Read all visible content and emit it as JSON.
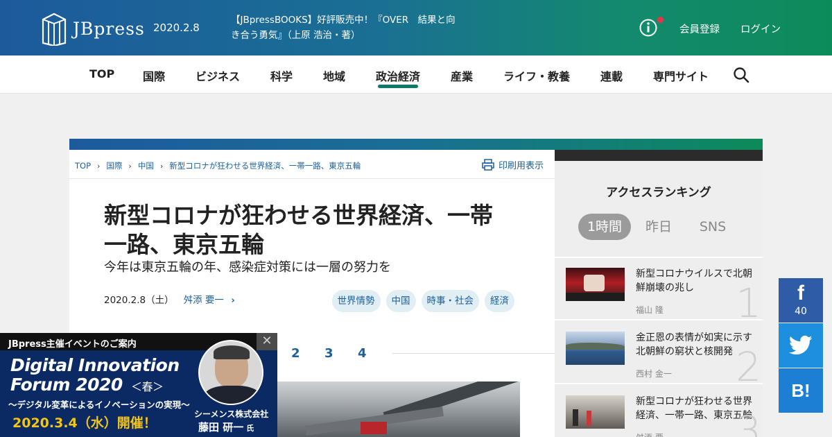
{
  "header": {
    "logo_text": "JBpress",
    "date": "2020.2.8",
    "promo_line1": "【JBpressBOOKS】好評販売中！『OVER　結果と向",
    "promo_line2": "き合う勇気』（上原 浩治・著）",
    "register": "会員登録",
    "login": "ログイン"
  },
  "nav": {
    "items": [
      "TOP",
      "国際",
      "ビジネス",
      "科学",
      "地域",
      "政治経済",
      "産業",
      "ライフ・教養",
      "連載",
      "専門サイト"
    ],
    "active": "政治経済"
  },
  "breadcrumb": [
    "TOP",
    "国際",
    "中国",
    "新型コロナが狂わせる世界経済、一帯一路、東京五輪"
  ],
  "print_label": "印刷用表示",
  "article": {
    "title_line1": "新型コロナが狂わせる世界経済、一帯",
    "title_line2": "一路、東京五輪",
    "subtitle": "今年は東京五輪の年、感染症対策には一層の努力を",
    "date": "2020.2.8（土）",
    "author": "舛添 要一",
    "tags": [
      "世界情勢",
      "中国",
      "時事・社会",
      "経済"
    ],
    "pages": [
      "2",
      "3",
      "4"
    ]
  },
  "ranking": {
    "title": "アクセスランキング",
    "tabs": [
      "1時間",
      "昨日",
      "SNS"
    ],
    "active_tab": "1時間",
    "items": [
      {
        "rank": "1",
        "headline": "新型コロナウイルスで北朝鮮崩壊の兆し",
        "author": "福山 隆"
      },
      {
        "rank": "2",
        "headline": "金正恩の表情が如実に示す北朝鮮の窮状と核開発",
        "author": "西村 金一"
      },
      {
        "rank": "3",
        "headline": "新型コロナが狂わせる世界経済、一帯一路、東京五輪",
        "author": "舛添 要一"
      }
    ]
  },
  "share": {
    "facebook_count": "40",
    "facebook_glyph": "f",
    "hatena_glyph": "B!"
  },
  "event": {
    "header": "JBpress主催イベントのご案内",
    "close_glyph": "✕",
    "title_line1": "Digital Innovation",
    "title_line2": "Forum 2020",
    "title_suffix": "＜春＞",
    "subtitle": "～デジタル変革によるイノベーションの実現～",
    "date": "2020.3.4（水）開催！",
    "company": "シーメンス株式会社",
    "person": "藤田 研一",
    "honorific": "氏"
  },
  "colors": {
    "header_gradient_start": "#1d5a9c",
    "header_gradient_end": "#0c8b5a",
    "link_blue": "#1a5f9e",
    "nav_underline": "#0c7a6a",
    "event_bg": "#0b2a64",
    "event_date": "#f5c518"
  }
}
